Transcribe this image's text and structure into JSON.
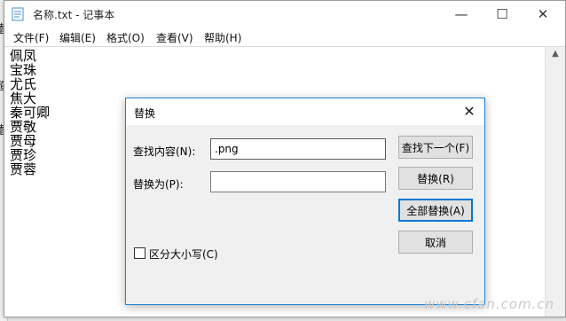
{
  "background_app": {
    "glyphs": [
      "替",
      "查",
      "替"
    ]
  },
  "window": {
    "title": "名称.txt - 记事本",
    "controls": {
      "minimize": "—",
      "maximize": "☐",
      "close": "✕"
    }
  },
  "menu": [
    "文件(F)",
    "编辑(E)",
    "格式(O)",
    "查看(V)",
    "帮助(H)"
  ],
  "editor": {
    "lines": [
      "佩凤",
      "宝珠",
      "尤氏",
      "焦大",
      "秦可卿",
      "贾敬",
      "贾母",
      "贾珍",
      "贾蓉"
    ]
  },
  "dialog": {
    "title": "替换",
    "close": "✕",
    "find_label": "查找内容(N):",
    "find_value": ".png",
    "replace_label": "替换为(P):",
    "replace_value": "",
    "buttons": {
      "find_next": "查找下一个(F)",
      "replace": "替换(R)",
      "replace_all": "全部替换(A)",
      "cancel": "取消"
    },
    "match_case_label": "区分大小写(C)",
    "match_case_checked": false
  },
  "watermark": "www.cfan.com.cn",
  "colors": {
    "accent": "#0078d7",
    "dialog_border": "#1883d7",
    "dialog_bg": "#f0f0f0"
  }
}
